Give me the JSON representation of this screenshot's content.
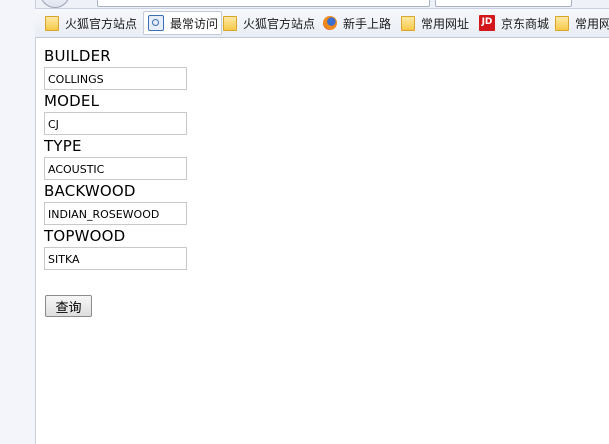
{
  "bookmarks": [
    {
      "label": "火狐官方站点",
      "icon": "folder-icon"
    },
    {
      "label": "最常访问",
      "icon": "page-icon"
    },
    {
      "label": "火狐官方站点",
      "icon": "folder-icon"
    },
    {
      "label": "新手上路",
      "icon": "firefox-icon"
    },
    {
      "label": "常用网址",
      "icon": "folder-icon"
    },
    {
      "label": "京东商城",
      "icon": "jd-icon",
      "icon_text": "JD"
    },
    {
      "label": "常用网址",
      "icon": "folder-icon"
    }
  ],
  "form": {
    "fields": [
      {
        "label": "BUILDER",
        "value": "COLLINGS"
      },
      {
        "label": "MODEL",
        "value": "CJ"
      },
      {
        "label": "TYPE",
        "value": "ACOUSTIC"
      },
      {
        "label": "BACKWOOD",
        "value": "INDIAN_ROSEWOOD"
      },
      {
        "label": "TOPWOOD",
        "value": "SITKA"
      }
    ],
    "submit_label": "查询"
  }
}
